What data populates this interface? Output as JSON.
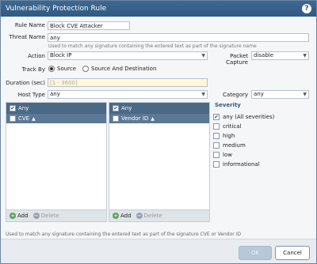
{
  "dialog": {
    "title": "Vulnerability Protection Rule",
    "help_icon": "?"
  },
  "form": {
    "rule_name": {
      "label": "Rule Name",
      "value": "Block CVE Attacker"
    },
    "threat_name": {
      "label": "Threat Name",
      "value": "any",
      "help": "Used to match any signature containing the entered text as part of the signature name"
    },
    "action": {
      "label": "Action",
      "value": "Block IP"
    },
    "packet_capture": {
      "label": "Packet Capture",
      "value": "disable"
    },
    "track_by": {
      "label": "Track By",
      "options": [
        "Source",
        "Source And Destination"
      ],
      "selected": "Source"
    },
    "duration": {
      "label": "Duration (sec)",
      "placeholder": "[1 - 3600]"
    },
    "host_type": {
      "label": "Host Type",
      "value": "any"
    },
    "category": {
      "label": "Category",
      "value": "any"
    }
  },
  "cve_panel": {
    "header": "Any",
    "column": "CVE",
    "add_label": "Add",
    "delete_label": "Delete"
  },
  "vendor_panel": {
    "header": "Any",
    "column": "Vendor ID",
    "add_label": "Add",
    "delete_label": "Delete"
  },
  "severity": {
    "title": "Severity",
    "items": [
      {
        "label": "any (All severities)",
        "checked": true
      },
      {
        "label": "critical",
        "checked": false
      },
      {
        "label": "high",
        "checked": false
      },
      {
        "label": "medium",
        "checked": false
      },
      {
        "label": "low",
        "checked": false
      },
      {
        "label": "informational",
        "checked": false
      }
    ]
  },
  "bottom_help": "Used to match any signature containing the entered text as part of the signature CVE or Vendor ID",
  "buttons": {
    "ok": "OK",
    "cancel": "Cancel"
  },
  "colors": {
    "titlebar": "#2f5a84",
    "panel_header": "#4a6986",
    "duration_bg": "#fff7d8"
  }
}
